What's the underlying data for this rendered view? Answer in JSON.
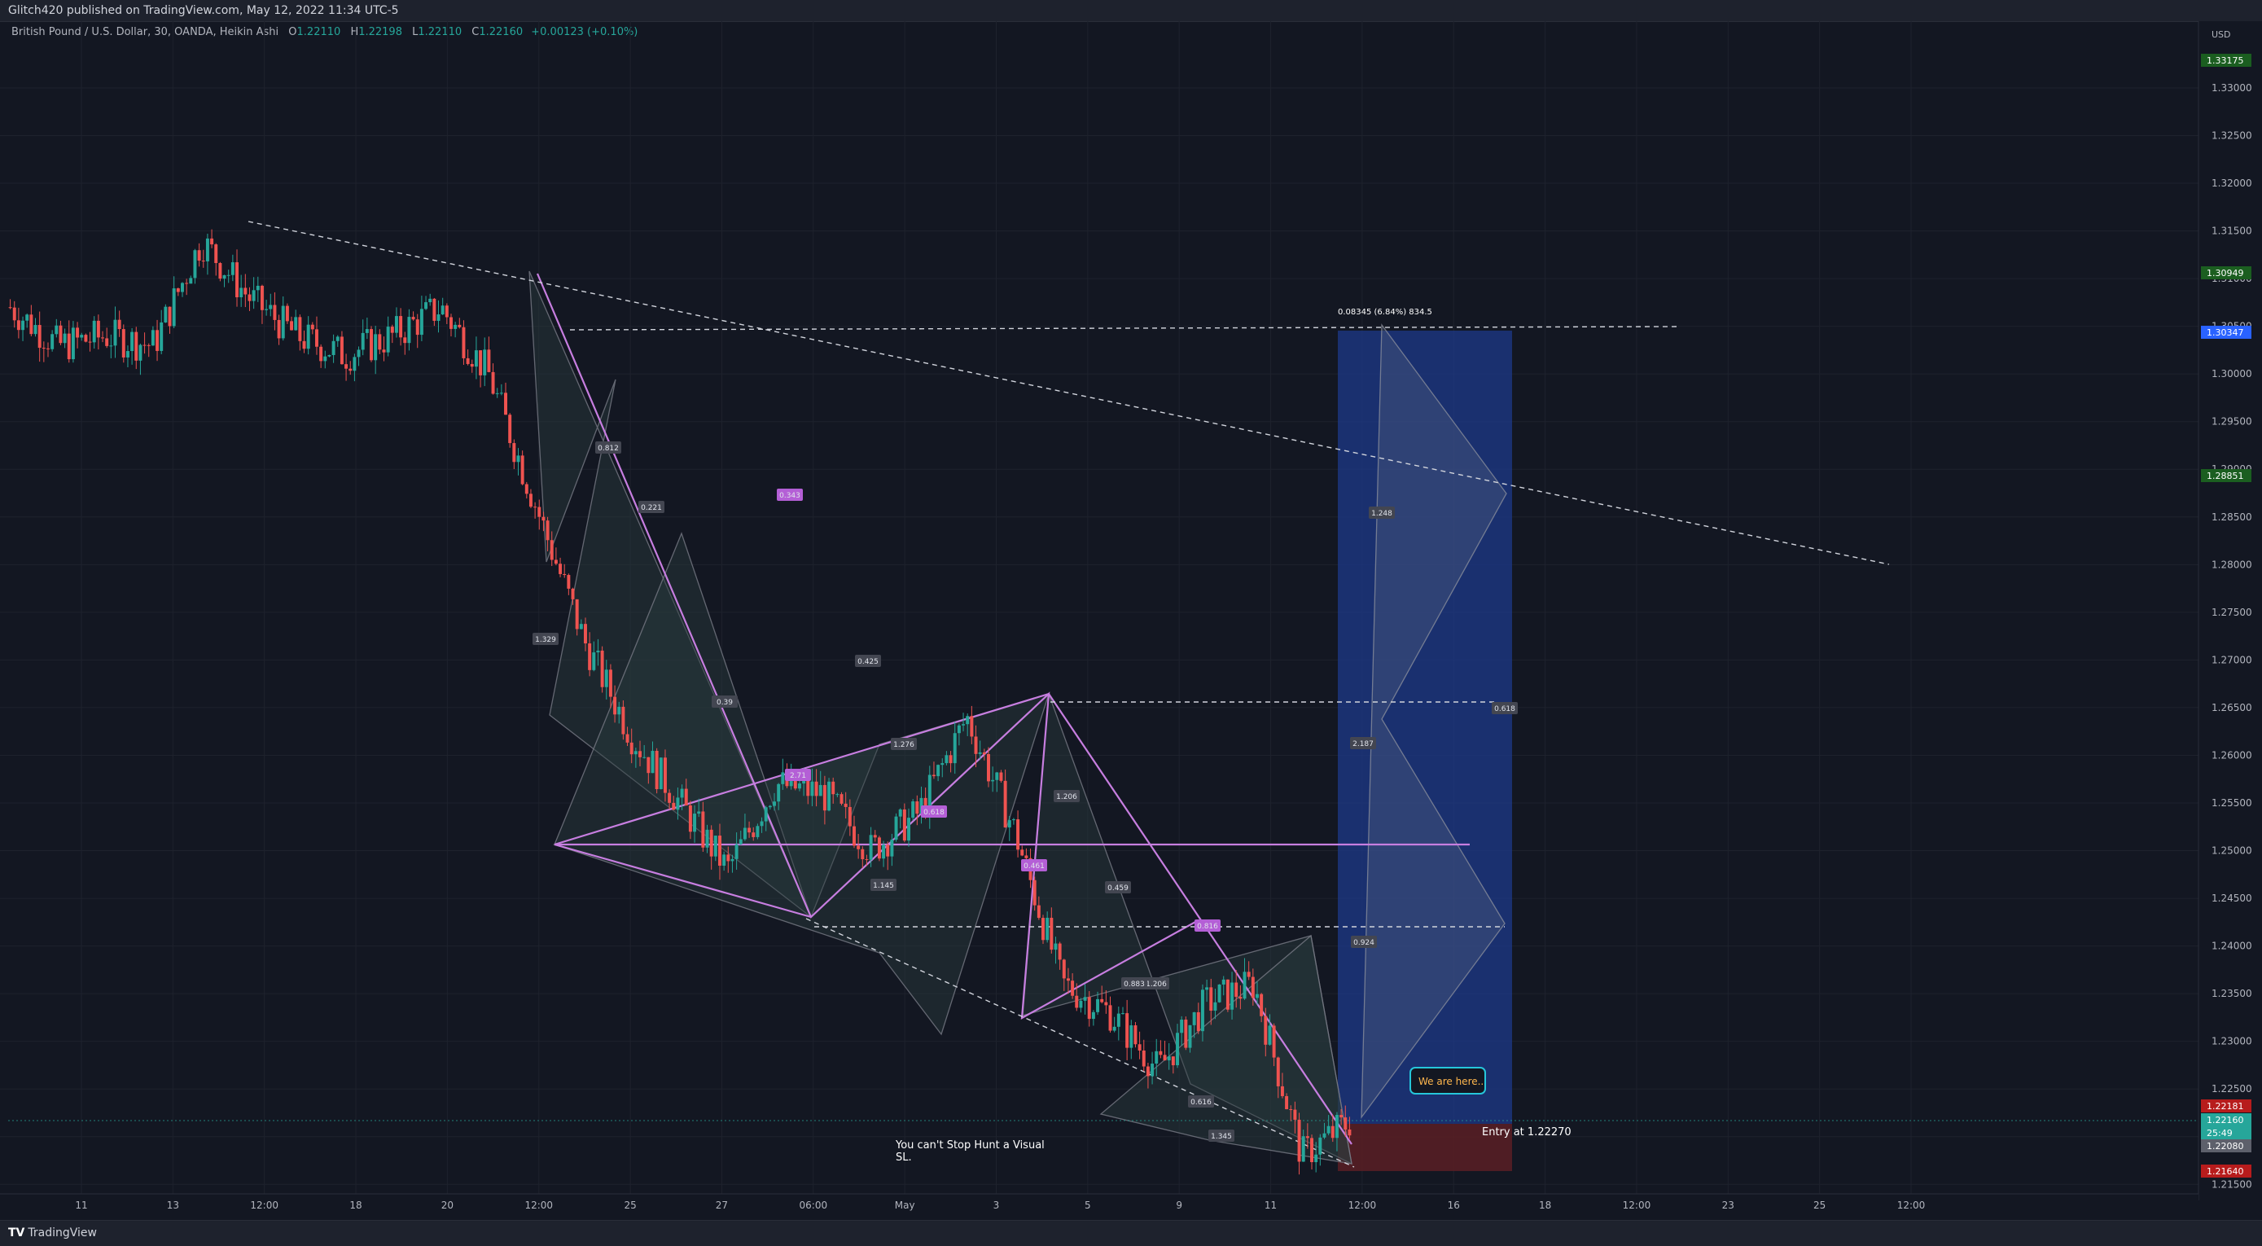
{
  "header": {
    "publisher": "Glitch420 published on TradingView.com, May 12, 2022 11:34 UTC-5"
  },
  "legend": {
    "symbol": "British Pound / U.S. Dollar, 30, OANDA, Heikin Ashi",
    "open_key": "O",
    "open": "1.22110",
    "high_key": "H",
    "high": "1.22198",
    "low_key": "L",
    "low": "1.22110",
    "close_key": "C",
    "close": "1.22160",
    "change": "+0.00123 (+0.10%)"
  },
  "footer": {
    "brand": "TradingView"
  },
  "annotations": {
    "stop_hunt": [
      "You can't Stop Hunt a Visual",
      "SL."
    ],
    "we_are_here": "We are here..",
    "entry": "Entry at  1.22270",
    "target_stats": "0.08345 (6.84%) 834.5"
  },
  "pattern_labels": [
    "0.343",
    "0.812",
    "0.221",
    "1.329",
    "0.39",
    "0.425",
    "1.276",
    "2.71",
    "0.618",
    "1.145",
    "0.461",
    "1.206",
    "0.459",
    "0.816",
    "1.248",
    "2.187",
    "0.924",
    "1.206",
    "0.883",
    "1.345",
    "0.618",
    "0.616"
  ],
  "colors": {
    "bg": "#131722",
    "up": "#26a69a",
    "down": "#ef5350",
    "pattern": "#c77ee0",
    "target_zone": "#1e3a8a",
    "stop_zone": "#5b1f24",
    "trend": "#d1d4dc"
  },
  "chart_data": {
    "type": "line",
    "title": "British Pound / U.S. Dollar, 30, OANDA, Heikin Ashi",
    "currency": "USD",
    "xlabel": "",
    "ylabel": "",
    "ylim": [
      1.214,
      1.337
    ],
    "grid": true,
    "y_ticks": [
      "1.33000",
      "1.32500",
      "1.32000",
      "1.31500",
      "1.31000",
      "1.30500",
      "1.30000",
      "1.29500",
      "1.29000",
      "1.28500",
      "1.28000",
      "1.27500",
      "1.27000",
      "1.26500",
      "1.26000",
      "1.25500",
      "1.25000",
      "1.24500",
      "1.24000",
      "1.23500",
      "1.23000",
      "1.22500",
      "1.22000",
      "1.21500"
    ],
    "x_ticks": [
      "11",
      "13",
      "12:00",
      "18",
      "20",
      "12:00",
      "25",
      "27",
      "06:00",
      "May",
      "3",
      "5",
      "9",
      "11",
      "12:00",
      "16",
      "18",
      "12:00",
      "23",
      "25",
      "12:00"
    ],
    "price_tags": [
      {
        "value": "1.33175",
        "color": "#1b5e20"
      },
      {
        "value": "1.30949",
        "color": "#1b5e20"
      },
      {
        "value": "1.30347",
        "color": "#2962ff"
      },
      {
        "value": "1.28851",
        "color": "#1b5e20"
      },
      {
        "value": "1.22181",
        "color": "#b71c1c"
      },
      {
        "value": "1.22160",
        "color": "#26a69a"
      },
      {
        "value": "25:49",
        "color": "#26a69a"
      },
      {
        "value": "1.22080",
        "color": "#5d606b"
      },
      {
        "value": "1.21640",
        "color": "#b71c1c"
      }
    ],
    "series": [
      {
        "x": [
          "Apr 8",
          "Apr 10",
          "Apr 12",
          "Apr 13",
          "Apr 14",
          "Apr 15",
          "Apr 18",
          "Apr 19",
          "Apr 20",
          "Apr 21",
          "Apr 22",
          "Apr 24",
          "Apr 25",
          "Apr 26",
          "Apr 27",
          "Apr 28",
          "Apr 29",
          "May 1",
          "May 2",
          "May 3",
          "May 4",
          "May 5",
          "May 6",
          "May 8",
          "May 9",
          "May 10",
          "May 11",
          "May 12",
          "May 12 11:30"
        ],
        "values": [
          1.307,
          1.303,
          1.304,
          1.303,
          1.314,
          1.308,
          1.304,
          1.302,
          1.304,
          1.307,
          1.3,
          1.286,
          1.272,
          1.262,
          1.255,
          1.248,
          1.257,
          1.256,
          1.25,
          1.254,
          1.264,
          1.252,
          1.236,
          1.233,
          1.227,
          1.234,
          1.236,
          1.218,
          1.2216
        ]
      }
    ]
  }
}
